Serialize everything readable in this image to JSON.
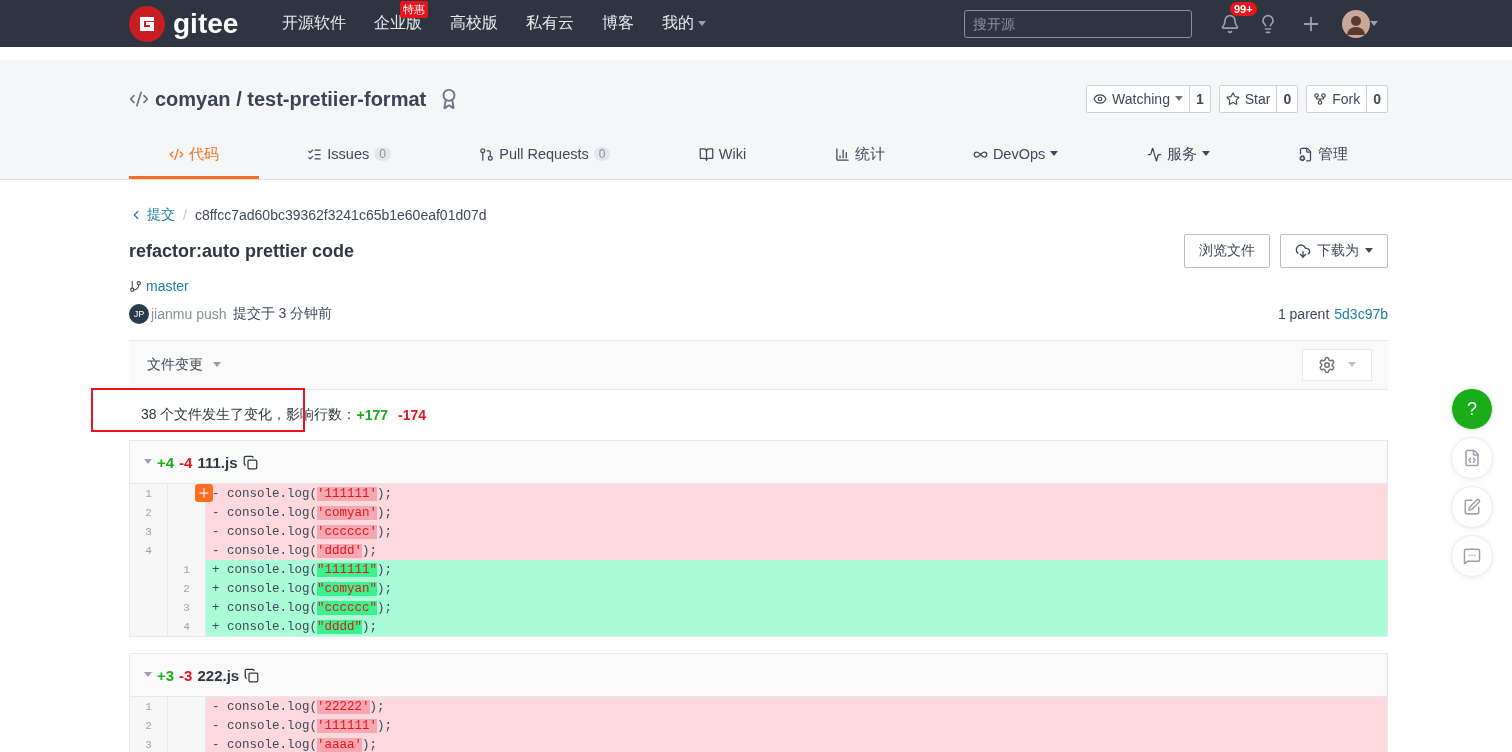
{
  "topbar": {
    "logo": "gitee",
    "nav": [
      {
        "label": "开源软件"
      },
      {
        "label": "企业版",
        "badge": "特惠"
      },
      {
        "label": "高校版"
      },
      {
        "label": "私有云"
      },
      {
        "label": "博客"
      },
      {
        "label": "我的",
        "dropdown": true
      }
    ],
    "search": {
      "placeholder": "搜开源"
    },
    "notifications": "99+"
  },
  "repo": {
    "owner": "comyan",
    "separator": "/",
    "name": "test-pretiier-format",
    "actions": [
      {
        "label": "Watching",
        "count": "1",
        "dropdown": true,
        "kind": "watch"
      },
      {
        "label": "Star",
        "count": "0",
        "kind": "star"
      },
      {
        "label": "Fork",
        "count": "0",
        "kind": "fork"
      }
    ],
    "tabs": [
      {
        "label": "代码",
        "kind": "code",
        "selected": true
      },
      {
        "label": "Issues",
        "count": "0",
        "kind": "issues",
        "selected": false
      },
      {
        "label": "Pull Requests",
        "count": "0",
        "kind": "pr",
        "selected": false
      },
      {
        "label": "Wiki",
        "kind": "wiki",
        "selected": false
      },
      {
        "label": "统计",
        "kind": "stats",
        "selected": false
      },
      {
        "label": "DevOps",
        "kind": "devops",
        "dropdown": true,
        "selected": false
      },
      {
        "label": "服务",
        "kind": "service",
        "dropdown": true,
        "selected": false
      },
      {
        "label": "管理",
        "kind": "admin",
        "selected": false
      }
    ]
  },
  "commit": {
    "back": "提交",
    "sep": "/",
    "hash": "c8ffcc7ad60bc39362f3241c65b1e60eaf01d07d",
    "title": "refactor:auto prettier code",
    "buttons": [
      {
        "label": "浏览文件",
        "kind": "browse"
      },
      {
        "label": "下载为",
        "kind": "download"
      }
    ],
    "branch": "master",
    "avatar": "JP",
    "author": "jianmu push",
    "time": "提交于 3 分钟前",
    "parent_label": "1 parent",
    "parent": "5d3c97b"
  },
  "file_changes": {
    "label": "文件变更"
  },
  "summary": {
    "text": "38 个文件发生了变化，影响行数：",
    "added": "+177",
    "removed": "-174",
    "highlighted": true
  },
  "files": [
    {
      "added": "+4",
      "removed": "-4",
      "name": "111.js",
      "lines": [
        {
          "kind": "del",
          "old": "1",
          "sign": "-",
          "before": "console.log(",
          "literal": "'111111'",
          "after": ");",
          "comment_button": true
        },
        {
          "kind": "del",
          "old": "2",
          "sign": "-",
          "before": "console.log(",
          "literal": "'comyan'",
          "after": ");"
        },
        {
          "kind": "del",
          "old": "3",
          "sign": "-",
          "before": "console.log(",
          "literal": "'cccccc'",
          "after": ");"
        },
        {
          "kind": "del",
          "old": "4",
          "sign": "-",
          "before": "console.log(",
          "literal": "'dddd'",
          "after": ");"
        },
        {
          "kind": "add",
          "new": "1",
          "sign": "+",
          "before": "console.log(",
          "literal": "\"111111\"",
          "after": ");"
        },
        {
          "kind": "add",
          "new": "2",
          "sign": "+",
          "before": "console.log(",
          "literal": "\"comyan\"",
          "after": ");"
        },
        {
          "kind": "add",
          "new": "3",
          "sign": "+",
          "before": "console.log(",
          "literal": "\"cccccc\"",
          "after": ");"
        },
        {
          "kind": "add",
          "new": "4",
          "sign": "+",
          "before": "console.log(",
          "literal": "\"dddd\"",
          "after": ");"
        }
      ]
    },
    {
      "added": "+3",
      "removed": "-3",
      "name": "222.js",
      "lines": [
        {
          "kind": "del",
          "old": "1",
          "sign": "-",
          "before": "console.log(",
          "literal": "'22222'",
          "after": ");"
        },
        {
          "kind": "del",
          "old": "2",
          "sign": "-",
          "before": "console.log(",
          "literal": "'111111'",
          "after": ");"
        },
        {
          "kind": "del",
          "old": "3",
          "sign": "-",
          "before": "console.log(",
          "literal": "'aaaa'",
          "after": ");"
        }
      ]
    }
  ],
  "float_buttons": [
    {
      "kind": "help",
      "label": "?"
    },
    {
      "kind": "code"
    },
    {
      "kind": "edit"
    },
    {
      "kind": "chat"
    }
  ]
}
